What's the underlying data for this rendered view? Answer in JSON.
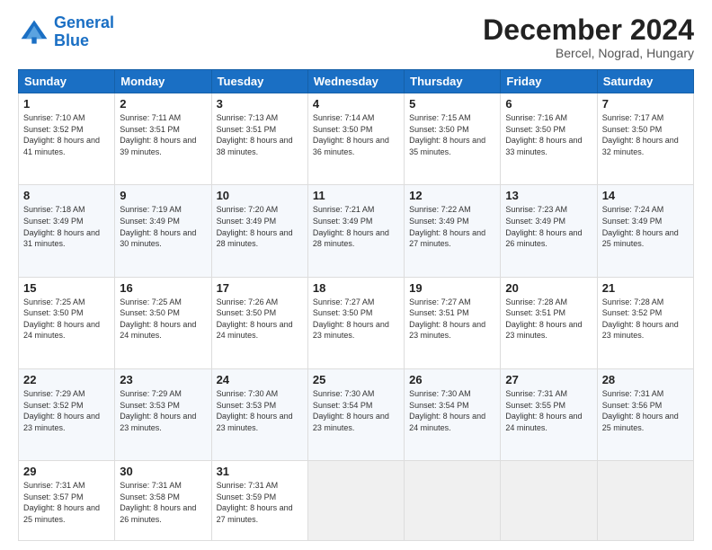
{
  "header": {
    "logo_line1": "General",
    "logo_line2": "Blue",
    "month": "December 2024",
    "location": "Bercel, Nograd, Hungary"
  },
  "weekdays": [
    "Sunday",
    "Monday",
    "Tuesday",
    "Wednesday",
    "Thursday",
    "Friday",
    "Saturday"
  ],
  "weeks": [
    [
      {
        "day": "1",
        "sunrise": "7:10 AM",
        "sunset": "3:52 PM",
        "daylight": "8 hours and 41 minutes."
      },
      {
        "day": "2",
        "sunrise": "7:11 AM",
        "sunset": "3:51 PM",
        "daylight": "8 hours and 39 minutes."
      },
      {
        "day": "3",
        "sunrise": "7:13 AM",
        "sunset": "3:51 PM",
        "daylight": "8 hours and 38 minutes."
      },
      {
        "day": "4",
        "sunrise": "7:14 AM",
        "sunset": "3:50 PM",
        "daylight": "8 hours and 36 minutes."
      },
      {
        "day": "5",
        "sunrise": "7:15 AM",
        "sunset": "3:50 PM",
        "daylight": "8 hours and 35 minutes."
      },
      {
        "day": "6",
        "sunrise": "7:16 AM",
        "sunset": "3:50 PM",
        "daylight": "8 hours and 33 minutes."
      },
      {
        "day": "7",
        "sunrise": "7:17 AM",
        "sunset": "3:50 PM",
        "daylight": "8 hours and 32 minutes."
      }
    ],
    [
      {
        "day": "8",
        "sunrise": "7:18 AM",
        "sunset": "3:49 PM",
        "daylight": "8 hours and 31 minutes."
      },
      {
        "day": "9",
        "sunrise": "7:19 AM",
        "sunset": "3:49 PM",
        "daylight": "8 hours and 30 minutes."
      },
      {
        "day": "10",
        "sunrise": "7:20 AM",
        "sunset": "3:49 PM",
        "daylight": "8 hours and 28 minutes."
      },
      {
        "day": "11",
        "sunrise": "7:21 AM",
        "sunset": "3:49 PM",
        "daylight": "8 hours and 28 minutes."
      },
      {
        "day": "12",
        "sunrise": "7:22 AM",
        "sunset": "3:49 PM",
        "daylight": "8 hours and 27 minutes."
      },
      {
        "day": "13",
        "sunrise": "7:23 AM",
        "sunset": "3:49 PM",
        "daylight": "8 hours and 26 minutes."
      },
      {
        "day": "14",
        "sunrise": "7:24 AM",
        "sunset": "3:49 PM",
        "daylight": "8 hours and 25 minutes."
      }
    ],
    [
      {
        "day": "15",
        "sunrise": "7:25 AM",
        "sunset": "3:50 PM",
        "daylight": "8 hours and 24 minutes."
      },
      {
        "day": "16",
        "sunrise": "7:25 AM",
        "sunset": "3:50 PM",
        "daylight": "8 hours and 24 minutes."
      },
      {
        "day": "17",
        "sunrise": "7:26 AM",
        "sunset": "3:50 PM",
        "daylight": "8 hours and 24 minutes."
      },
      {
        "day": "18",
        "sunrise": "7:27 AM",
        "sunset": "3:50 PM",
        "daylight": "8 hours and 23 minutes."
      },
      {
        "day": "19",
        "sunrise": "7:27 AM",
        "sunset": "3:51 PM",
        "daylight": "8 hours and 23 minutes."
      },
      {
        "day": "20",
        "sunrise": "7:28 AM",
        "sunset": "3:51 PM",
        "daylight": "8 hours and 23 minutes."
      },
      {
        "day": "21",
        "sunrise": "7:28 AM",
        "sunset": "3:52 PM",
        "daylight": "8 hours and 23 minutes."
      }
    ],
    [
      {
        "day": "22",
        "sunrise": "7:29 AM",
        "sunset": "3:52 PM",
        "daylight": "8 hours and 23 minutes."
      },
      {
        "day": "23",
        "sunrise": "7:29 AM",
        "sunset": "3:53 PM",
        "daylight": "8 hours and 23 minutes."
      },
      {
        "day": "24",
        "sunrise": "7:30 AM",
        "sunset": "3:53 PM",
        "daylight": "8 hours and 23 minutes."
      },
      {
        "day": "25",
        "sunrise": "7:30 AM",
        "sunset": "3:54 PM",
        "daylight": "8 hours and 23 minutes."
      },
      {
        "day": "26",
        "sunrise": "7:30 AM",
        "sunset": "3:54 PM",
        "daylight": "8 hours and 24 minutes."
      },
      {
        "day": "27",
        "sunrise": "7:31 AM",
        "sunset": "3:55 PM",
        "daylight": "8 hours and 24 minutes."
      },
      {
        "day": "28",
        "sunrise": "7:31 AM",
        "sunset": "3:56 PM",
        "daylight": "8 hours and 25 minutes."
      }
    ],
    [
      {
        "day": "29",
        "sunrise": "7:31 AM",
        "sunset": "3:57 PM",
        "daylight": "8 hours and 25 minutes."
      },
      {
        "day": "30",
        "sunrise": "7:31 AM",
        "sunset": "3:58 PM",
        "daylight": "8 hours and 26 minutes."
      },
      {
        "day": "31",
        "sunrise": "7:31 AM",
        "sunset": "3:59 PM",
        "daylight": "8 hours and 27 minutes."
      },
      null,
      null,
      null,
      null
    ]
  ],
  "labels": {
    "sunrise": "Sunrise:",
    "sunset": "Sunset:",
    "daylight": "Daylight:"
  }
}
